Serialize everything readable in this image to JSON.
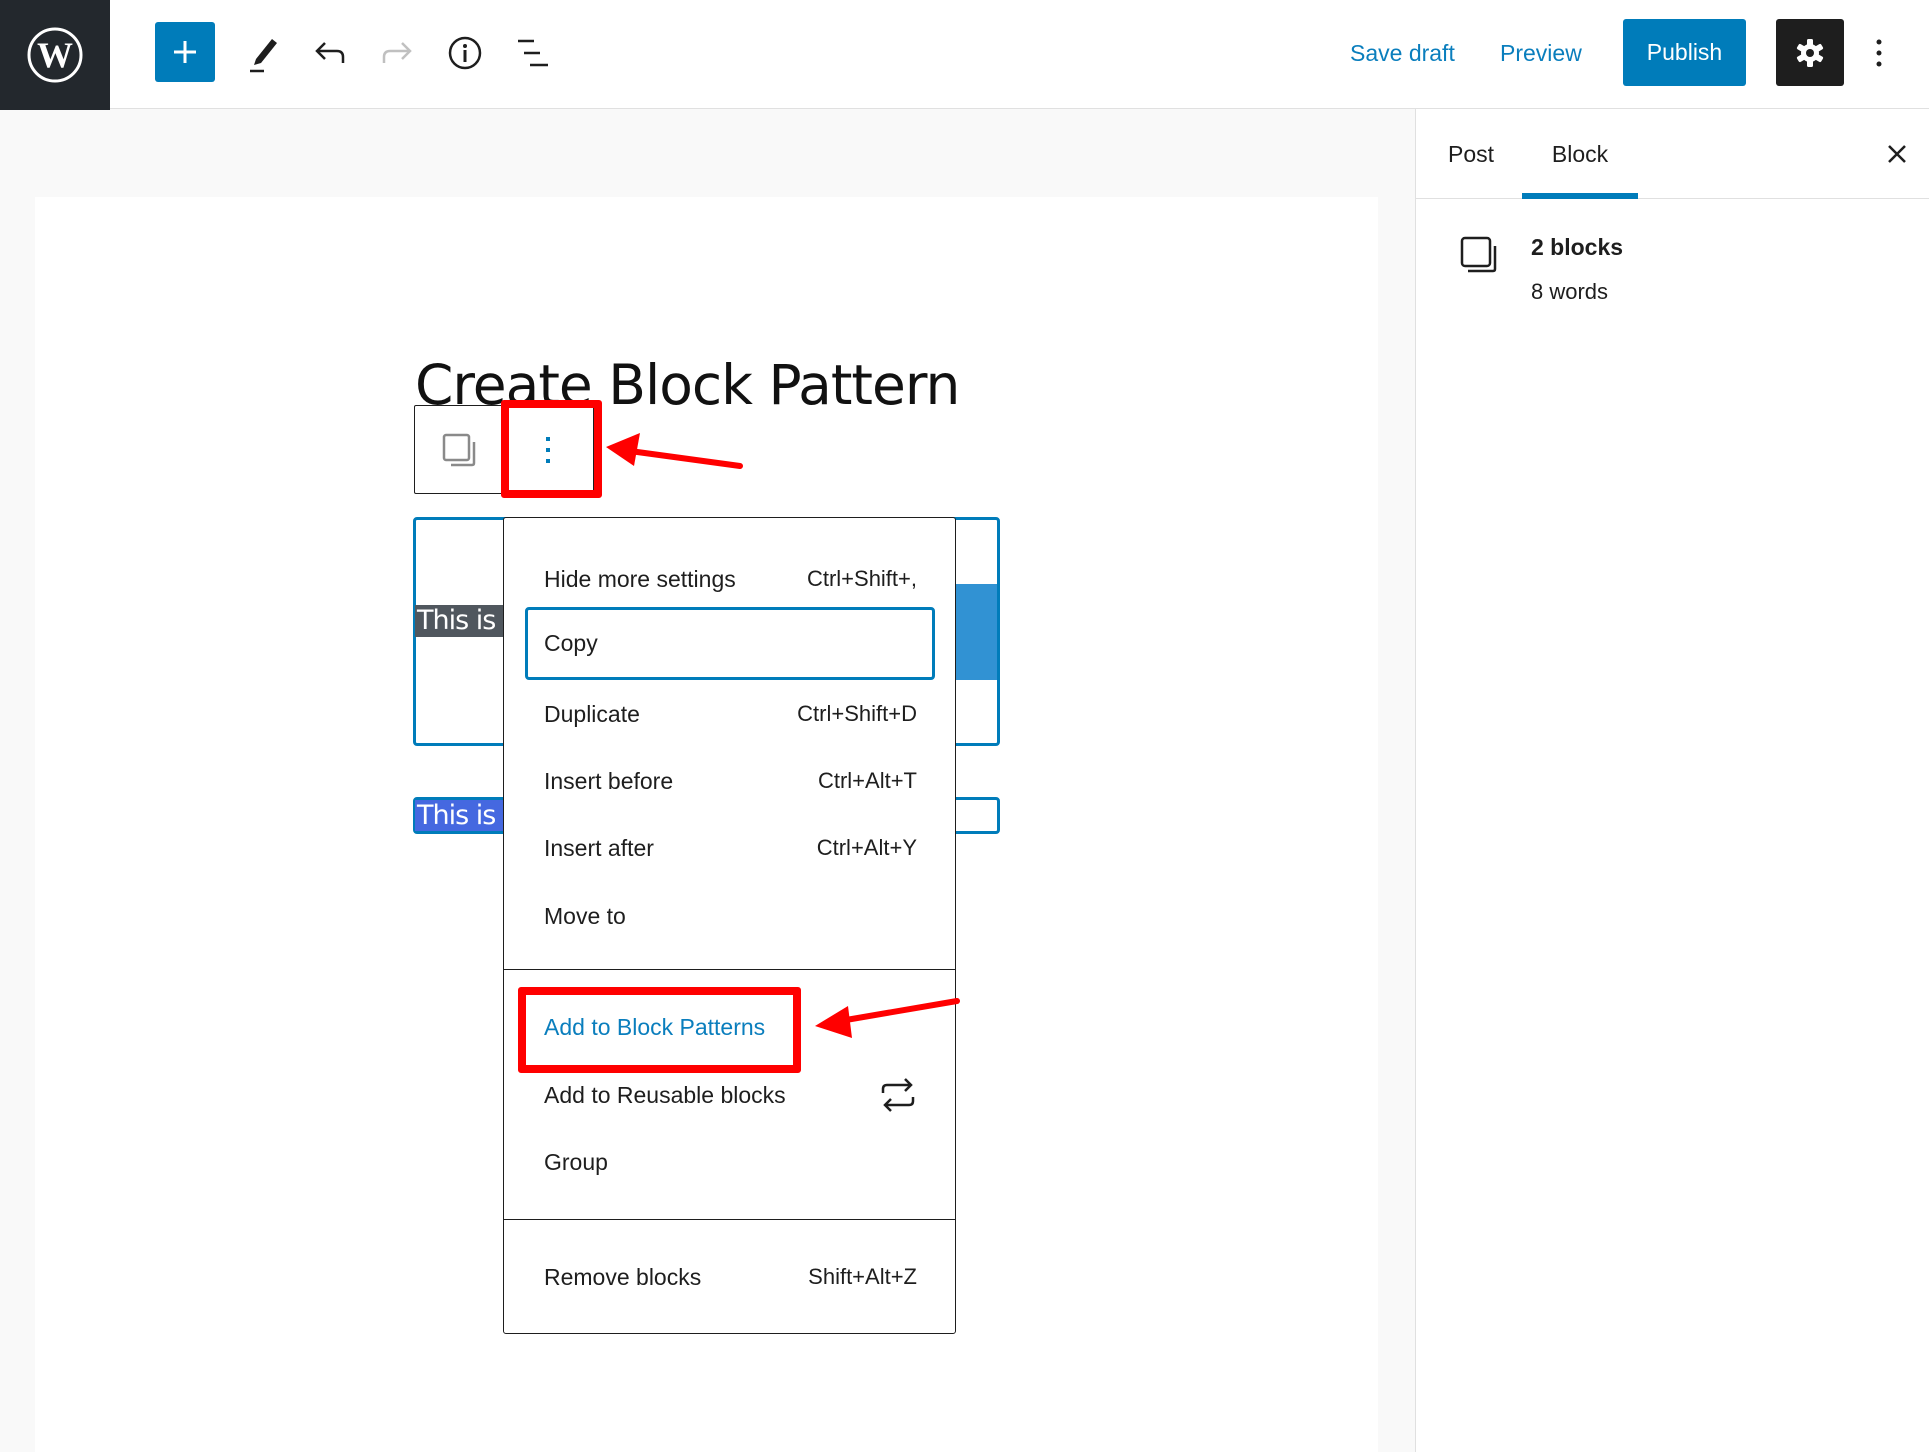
{
  "header": {
    "logo": "wordpress-logo",
    "tools": [
      {
        "name": "add-block",
        "icon": "plus-icon"
      },
      {
        "name": "tools",
        "icon": "pencil-icon"
      },
      {
        "name": "undo",
        "icon": "undo-icon"
      },
      {
        "name": "redo",
        "icon": "redo-icon",
        "disabled": true
      },
      {
        "name": "details",
        "icon": "info-icon"
      },
      {
        "name": "list-view",
        "icon": "list-view-icon"
      }
    ],
    "save_draft_label": "Save draft",
    "preview_label": "Preview",
    "publish_label": "Publish",
    "settings_icon": "gear-icon",
    "more_icon": "vertical-ellipsis-icon"
  },
  "editor": {
    "post_title": "Create Block Pattern",
    "block1_text_visible": "This is t",
    "block2_text_visible": "This is t"
  },
  "block_menu": {
    "items": [
      {
        "label": "Hide more settings",
        "shortcut": "Ctrl+Shift+,"
      },
      {
        "label": "Copy",
        "shortcut": "",
        "focused": true
      },
      {
        "label": "Duplicate",
        "shortcut": "Ctrl+Shift+D"
      },
      {
        "label": "Insert before",
        "shortcut": "Ctrl+Alt+T"
      },
      {
        "label": "Insert after",
        "shortcut": "Ctrl+Alt+Y"
      },
      {
        "label": "Move to",
        "shortcut": ""
      }
    ],
    "plugin_items": [
      {
        "label": "Add to Block Patterns",
        "highlighted": true
      },
      {
        "label": "Add to Reusable blocks",
        "icon": "reusable-block-icon"
      },
      {
        "label": "Group"
      }
    ],
    "remove": {
      "label": "Remove blocks",
      "shortcut": "Shift+Alt+Z"
    }
  },
  "sidebar": {
    "tabs": [
      {
        "label": "Post",
        "active": false
      },
      {
        "label": "Block",
        "active": true
      }
    ],
    "close_icon": "close-icon",
    "block_card": {
      "title": "2 blocks",
      "subtitle": "8 words"
    }
  },
  "colors": {
    "accent": "#007cba",
    "annotation": "#ff0000",
    "logo_bg": "#23282d"
  }
}
